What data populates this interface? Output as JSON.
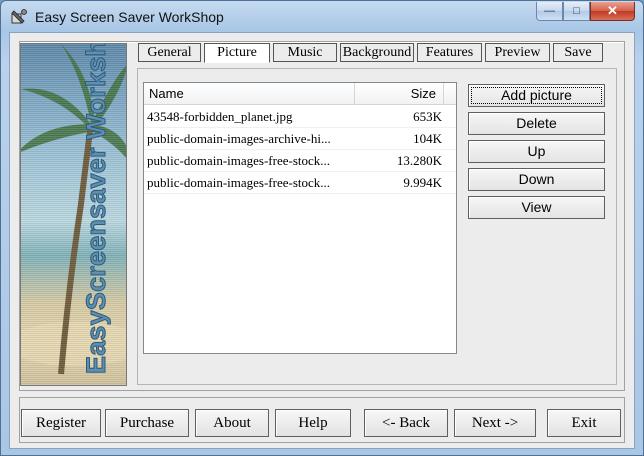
{
  "window": {
    "title": "Easy Screen Saver WorkShop",
    "icon": "app-icon"
  },
  "banner": {
    "text": "EasyScreensaver Workshop"
  },
  "tabs": [
    {
      "label": "General",
      "active": false
    },
    {
      "label": "Picture",
      "active": true
    },
    {
      "label": "Music",
      "active": false
    },
    {
      "label": "Background",
      "active": false
    },
    {
      "label": "Features",
      "active": false
    },
    {
      "label": "Preview",
      "active": false
    },
    {
      "label": "Save",
      "active": false
    }
  ],
  "list": {
    "columns": {
      "name": "Name",
      "size": "Size"
    },
    "rows": [
      {
        "name": "43548-forbidden_planet.jpg",
        "size": "653K"
      },
      {
        "name": "public-domain-images-archive-hi...",
        "size": "104K"
      },
      {
        "name": "public-domain-images-free-stock...",
        "size": "13.280K"
      },
      {
        "name": "public-domain-images-free-stock...",
        "size": "9.994K"
      }
    ]
  },
  "side_buttons": [
    {
      "label": "Add picture",
      "name": "add-picture-button",
      "focused": true
    },
    {
      "label": "Delete",
      "name": "delete-button",
      "focused": false
    },
    {
      "label": "Up",
      "name": "up-button",
      "focused": false
    },
    {
      "label": "Down",
      "name": "down-button",
      "focused": false
    },
    {
      "label": "View",
      "name": "view-button",
      "focused": false
    }
  ],
  "bottom_buttons": [
    {
      "label": "Register",
      "name": "register-button"
    },
    {
      "label": "Purchase",
      "name": "purchase-button"
    },
    {
      "label": "About",
      "name": "about-button"
    },
    {
      "label": "Help",
      "name": "help-button"
    },
    {
      "label": "<- Back",
      "name": "back-button"
    },
    {
      "label": "Next ->",
      "name": "next-button"
    },
    {
      "label": "Exit",
      "name": "exit-button"
    }
  ]
}
